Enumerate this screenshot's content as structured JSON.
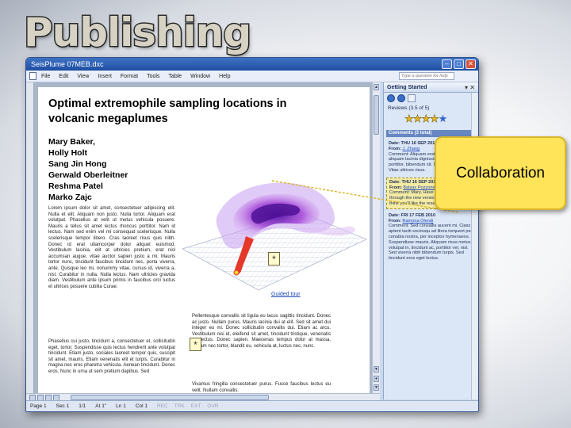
{
  "slide": {
    "title": "Publishing"
  },
  "window": {
    "title": "SeisPlume 07MEB.dxc"
  },
  "menu": [
    "File",
    "Edit",
    "View",
    "Insert",
    "Format",
    "Tools",
    "Table",
    "Window",
    "Help"
  ],
  "help_placeholder": "Type a question for help",
  "document": {
    "title": "Optimal extremophile sampling locations in volcanic megaplumes",
    "authors": [
      "Mary Baker,",
      "Holly Holt",
      "Sang Jin Hong",
      "Gerwald Oberleitner",
      "Reshma Patel",
      "Marko Zajc"
    ],
    "para1": "Lorem ipsum dolor sit amet, consectetuer adipiscing elit. Nulla et elit. Aliquam non justo. Nulla tortor. Aliquam erat volutpat. Phasellus at velit ut metus vehicula posuere. Mauris a tellus sit amet lectus rhoncus porttitor. Nam id lectus. Nam sed enim vel mi consequat scelerisque. Nulla scelerisque tempor libero. Cras laoreet risus quis nibh. Donec id erat ullamcorper dolor aliquet euismod. Vestibulum lacinia, elit at ultricies pretium, erat nisl accumsan augue, vitae auctor sapien justo a mi. Mauris tortor nunc, tincidunt faucibus tincidunt nec, porta viverra, ante. Quisque leo mi, nonummy vitae, cursus id, viverra a, nisl. Curabitur in nulla. Nulla lectus. Nam ultricies gravida diam. Vestibulum ante ipsum primis in faucibus orci luctus et ultrices posuere cubilia Curae;",
    "para2": "Phasellus cui justo, tincidunt a, consectetuer et, sollicitudin eget, tortor. Suspendisse quis lectus hendrerit ante volutpat tincidunt. Etiam justo, sociales laoreet tempor quis, suscipit sit amet, mauris. Etiam venenatis elit et turpis. Curabitur in magna nec eros pharetra vehicula. Aenean tincidunt. Donec eros. Nunc in urna ut sem pretium dapibus. Sed",
    "para3": "Pellentesque convallis sit ligula eu lacus sagittis tincidunt. Donec ac justo. Nullam purus. Mauris lacinia dui at elit. Sed sit amet dui integer eu mi. Donec sollicitudin convallis dui. Etiam ac arcu. Vestibulum nisi id, eleifend sit amet, tincidunt tristique, venenatis et, lectus. Donec sapien. Maecenas tempus dolor at massa. Nullam nec tortor, blandit eu, vehicula at, luctus nec, nunc.",
    "para4": "Vivamus fringilla consectetuer purus. Fusce faucibus lectus eu velit. Nullam convallis.",
    "caption_link": "Guided tour"
  },
  "statusbar": {
    "page": "Page 1",
    "sec": "Sec 1",
    "pages": "1/1",
    "at": "At 1\"",
    "ln": "Ln 1",
    "col": "Col 1",
    "modes": [
      "REC",
      "TRK",
      "EXT",
      "OVR"
    ]
  },
  "taskpane": {
    "title": "Getting Started",
    "reviews": "Reviews (3.5 of 5)",
    "rating": 3.5,
    "comments_header": "Comments (3 total)",
    "comments": [
      {
        "date": "Date: THU 16 SEP 2010",
        "from_label": "From: ",
        "from": "J. Zhang",
        "comment": "Comment: Aliquam erat volutpat. Etiam aliquam lacinia dignissim malesuada porttitor, bibendum sit. Nam felis phasellus. Vitae ultrices risus."
      },
      {
        "date": "Date: THU 16 SEP 2010",
        "from_label": "From: ",
        "from": "Balsas Pozzone",
        "comment": "Comment: Mary, Have you run this data through the new version 4.35 viscoder? I think you'll like the results a bit more."
      },
      {
        "date": "Date: FRI 17 FEB 2010",
        "from_label": "From: ",
        "from": "Ramona Olendi",
        "comment": "Comment: Sed convallis aucent mi. Class aptent taciti sociosqu ad litora torquent per conubia nostra, per inceptos hymenaeos. Suspendisse mauris. Aliquam risus metus, volutpat in, tincidunt ac, porttitor vel, nisl. Sed viverra nibh bibendum turpis. Sed tincidunt eros eget lectus."
      }
    ]
  },
  "callout": {
    "label": "Collaboration"
  }
}
